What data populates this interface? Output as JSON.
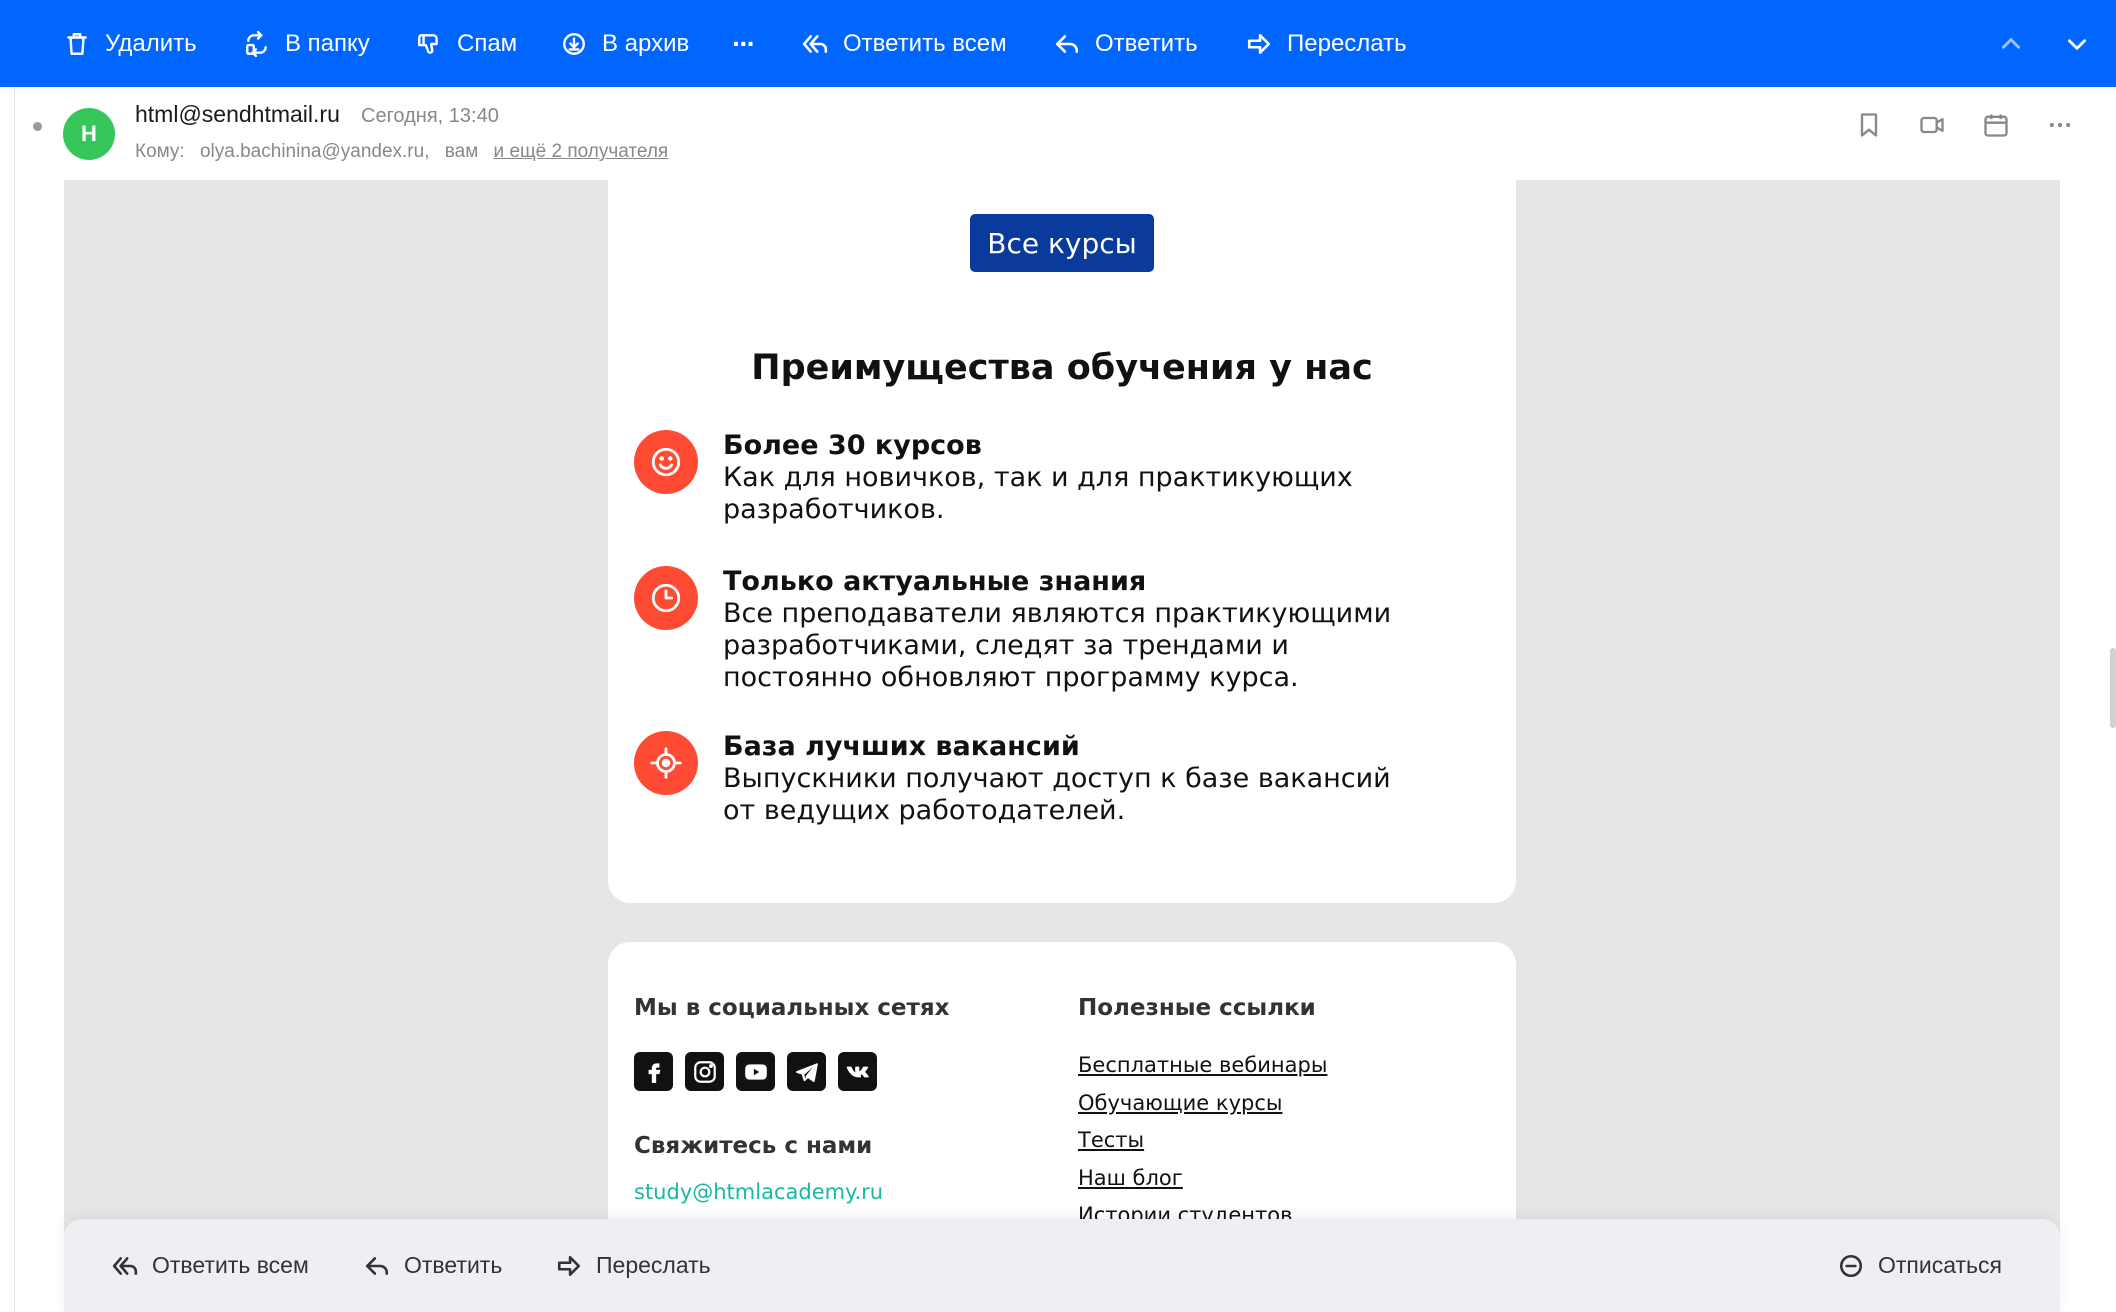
{
  "toolbar": {
    "delete": "Удалить",
    "to_folder": "В папку",
    "spam": "Спам",
    "archive": "В архив",
    "more": "···",
    "reply_all": "Ответить всем",
    "reply": "Ответить",
    "forward": "Переслать"
  },
  "message": {
    "avatar_letter": "H",
    "sender": "html@sendhtmail.ru",
    "date": "Сегодня, 13:40",
    "to_label": "Кому:",
    "to_address": "olya.bachinina@yandex.ru,",
    "to_you": "вам",
    "to_more": "и ещё 2 получателя"
  },
  "email": {
    "all_courses_button": "Все курсы",
    "advantages_title": "Преимущества обучения у нас",
    "features": [
      {
        "icon": "smile-icon",
        "title": "Более 30 курсов",
        "text": "Как для новичков, так и для практикующих разработчиков."
      },
      {
        "icon": "clock-icon",
        "title": "Только актуальные знания",
        "text": "Все преподаватели являются практикующими разработчиками, следят за трендами и постоянно обновляют программу курса."
      },
      {
        "icon": "target-icon",
        "title": "База лучших вакансий",
        "text": "Выпускники получают доступ к базе вакансий от ведущих работодателей."
      }
    ],
    "footer": {
      "social_heading": "Мы в социальных сетях",
      "social_icons": [
        "facebook-icon",
        "instagram-icon",
        "youtube-icon",
        "telegram-icon",
        "vk-icon"
      ],
      "contact_heading": "Свяжитесь с нами",
      "contact_email": "study@htmlacademy.ru",
      "links_heading": "Полезные ссылки",
      "links": [
        "Бесплатные вебинары",
        "Обучающие курсы",
        "Тесты",
        "Наш блог",
        "Истории студентов"
      ]
    }
  },
  "bottombar": {
    "reply_all": "Ответить всем",
    "reply": "Ответить",
    "forward": "Переслать",
    "unsubscribe": "Отписаться"
  },
  "colors": {
    "toolbar_bg": "#0066ff",
    "button_bg": "#0a3a9c",
    "feature_icon_bg": "#ff4b33",
    "avatar_bg": "#37c65a",
    "email_link": "#17b8a6"
  }
}
